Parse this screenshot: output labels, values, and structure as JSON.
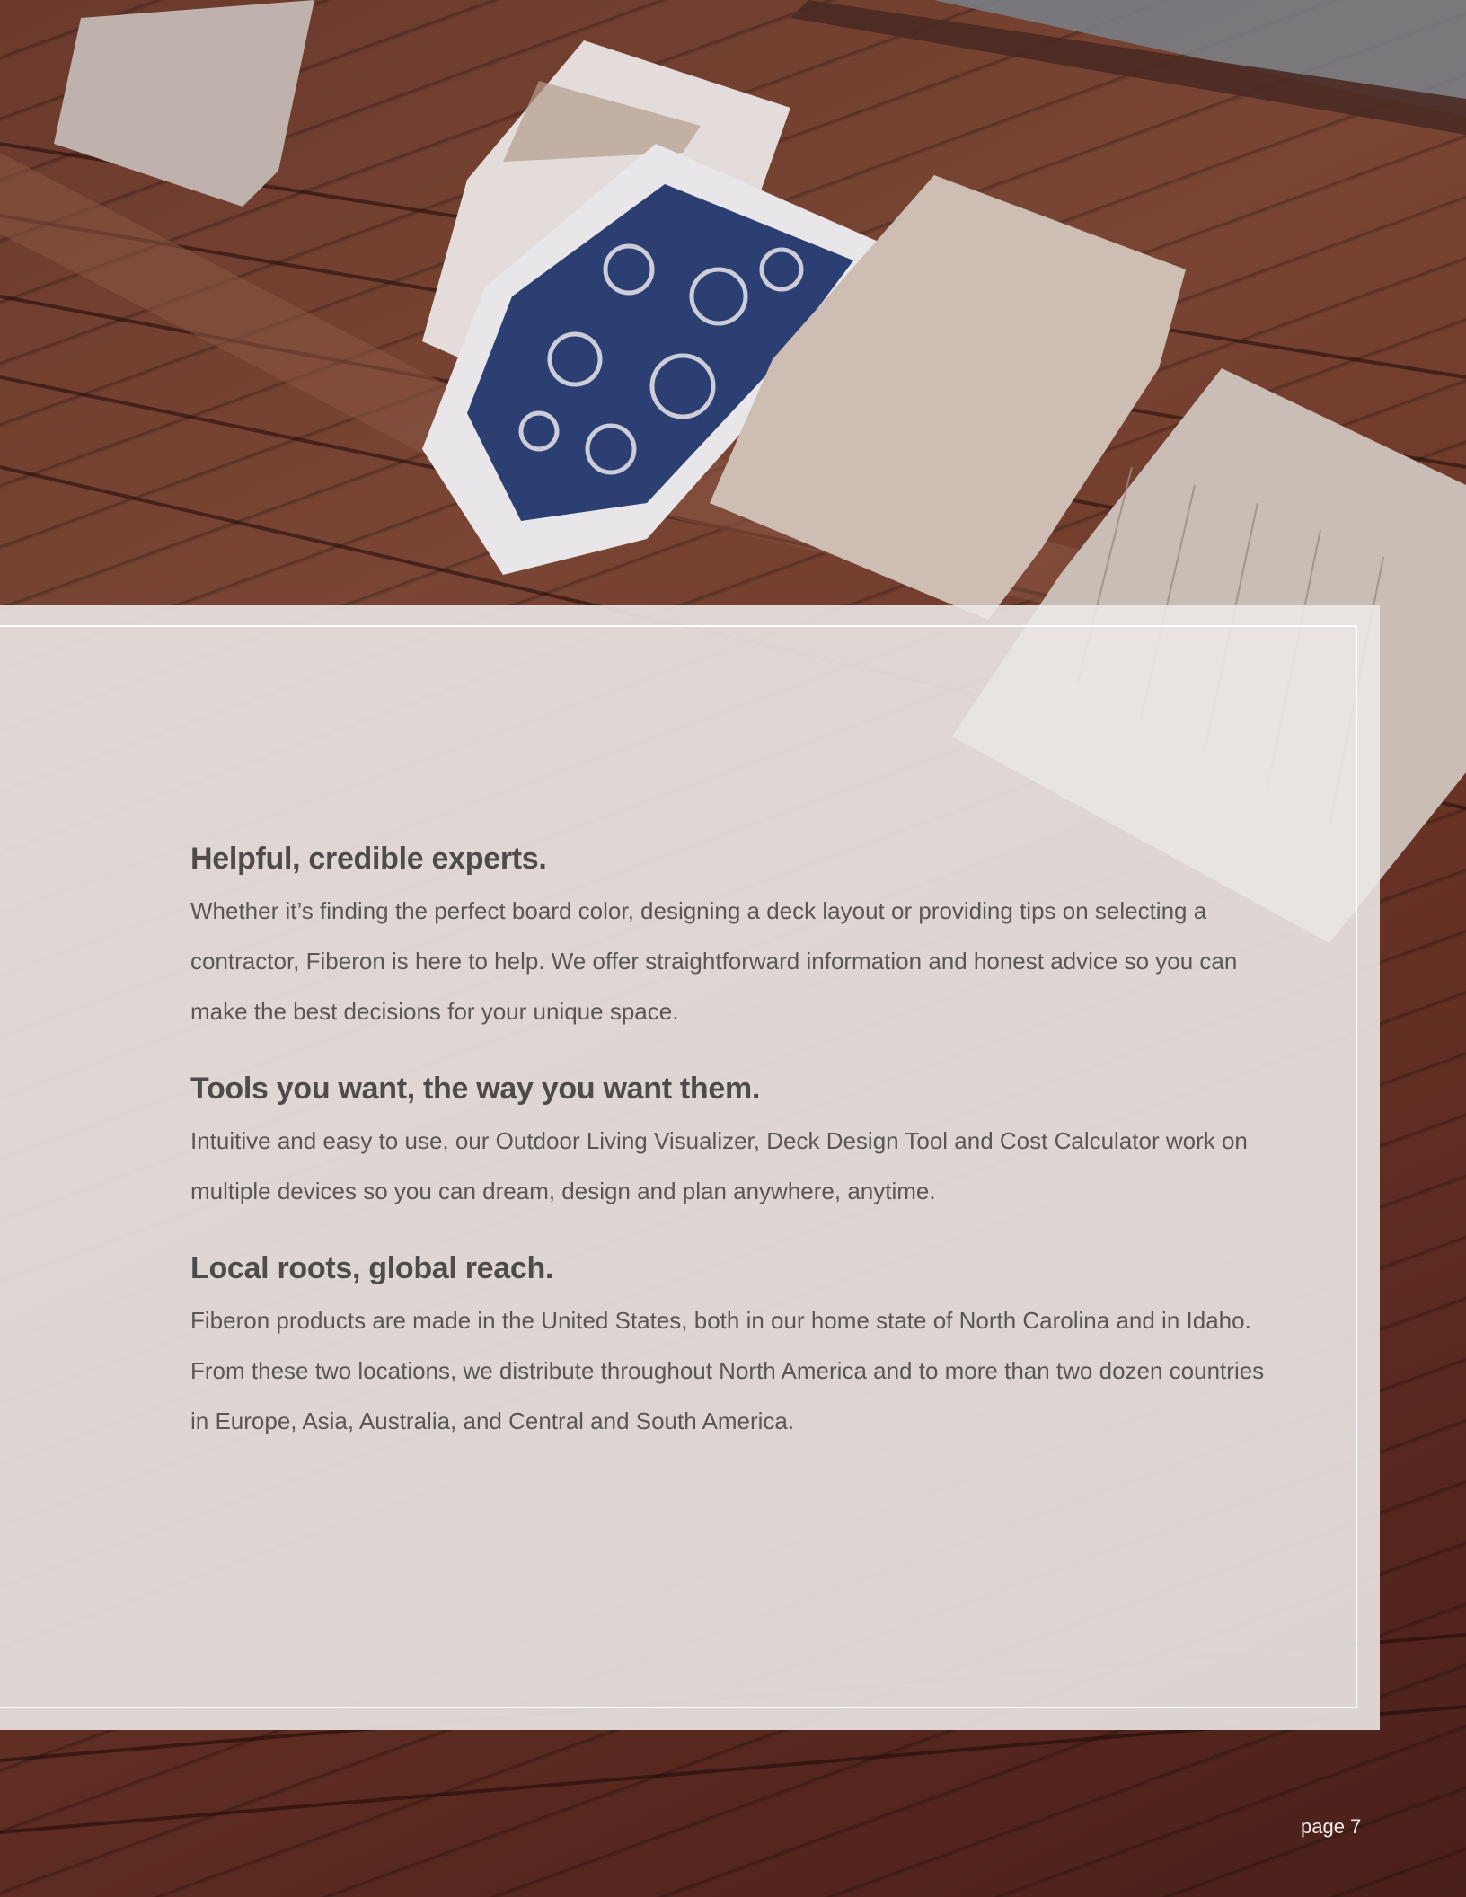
{
  "sections": [
    {
      "heading": "Helpful, credible experts.",
      "body": "Whether it’s finding the perfect board color, designing a deck layout or providing tips on selecting a contractor, Fiberon is here to help. We offer straightforward information and honest advice so you can make the best decisions for your unique space."
    },
    {
      "heading": "Tools you want, the way you want them.",
      "body": "Intuitive and easy to use, our Outdoor Living Visualizer, Deck Design Tool and Cost Calculator work on multiple devices so you can dream, design and plan anywhere, anytime."
    },
    {
      "heading": "Local roots, global reach.",
      "body": "Fiberon products are made in the United States, both in our home state of North Carolina and in Idaho. From these two locations, we distribute throughout North America and to more than two dozen countries in Europe, Asia, Australia, and Central and South America."
    }
  ],
  "footer": {
    "page_label": "page 7"
  },
  "colors": {
    "deck_wood": "#6b3a2c",
    "panel_overlay": "#ece8e7",
    "text": "#555150",
    "cushion_blue": "#2b3f72"
  }
}
